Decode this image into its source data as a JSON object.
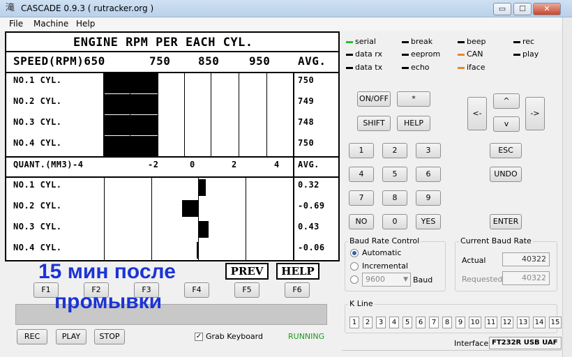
{
  "window": {
    "title": "CASCADE 0.9.3 ( rutracker.org )",
    "min": "▭",
    "max": "☐",
    "close": "✕",
    "app_icon": "滝"
  },
  "menu": [
    "File",
    "Machine",
    "Help"
  ],
  "lcd": {
    "title": "ENGINE RPM PER EACH CYL.",
    "rpm_header": {
      "label": "SPEED(RPM)650",
      "ticks": [
        "750",
        "850",
        "950"
      ],
      "avg": "AVG."
    },
    "rpm_rows": [
      {
        "label": "NO.1 CYL.",
        "value": "750"
      },
      {
        "label": "NO.2 CYL.",
        "value": "749"
      },
      {
        "label": "NO.3 CYL.",
        "value": "748"
      },
      {
        "label": "NO.4 CYL.",
        "value": "750"
      }
    ],
    "quant_header": {
      "label": "QUANT.(MM3)-4",
      "ticks": [
        "-2",
        "0",
        "2",
        "4"
      ],
      "avg": "AVG."
    },
    "quant_rows": [
      {
        "label": "NO.1 CYL.",
        "value": "0.32"
      },
      {
        "label": "NO.2 CYL.",
        "value": "-0.69"
      },
      {
        "label": "NO.3 CYL.",
        "value": "0.43"
      },
      {
        "label": "NO.4 CYL.",
        "value": "-0.06"
      }
    ],
    "softkeys": [
      "PREV",
      "HELP"
    ]
  },
  "overlay": {
    "line1": "15 мин после",
    "line2": "промывки"
  },
  "fkeys": [
    "F1",
    "F2",
    "F3",
    "F4",
    "F5",
    "F6"
  ],
  "bottom": {
    "rec": "REC",
    "play": "PLAY",
    "stop": "STOP",
    "grab_keyboard": "Grab Keyboard",
    "status": "RUNNING"
  },
  "leds": [
    {
      "label": "serial",
      "color": "#22c22a"
    },
    {
      "label": "break",
      "color": "#000000"
    },
    {
      "label": "beep",
      "color": "#000000"
    },
    {
      "label": "rec",
      "color": "#000000"
    },
    {
      "label": "data rx",
      "color": "#000000"
    },
    {
      "label": "eeprom",
      "color": "#000000"
    },
    {
      "label": "CAN",
      "color": "#e08a2c"
    },
    {
      "label": "play",
      "color": "#000000"
    },
    {
      "label": "data tx",
      "color": "#000000"
    },
    {
      "label": "echo",
      "color": "#000000"
    },
    {
      "label": "iface",
      "color": "#e08a2c"
    }
  ],
  "keys": {
    "onoff": "ON/OFF",
    "star": "*",
    "shift": "SHIFT",
    "help": "HELP",
    "left": "<-",
    "up": "^",
    "down": "v",
    "right": "->",
    "esc": "ESC",
    "undo": "UNDO",
    "enter": "ENTER",
    "no": "NO",
    "yes": "YES",
    "digits": [
      "1",
      "2",
      "3",
      "4",
      "5",
      "6",
      "7",
      "8",
      "9",
      "0"
    ]
  },
  "baud": {
    "title": "Baud Rate Control",
    "automatic": "Automatic",
    "incremental": "Incremental",
    "select_value": "9600",
    "baud_label": "Baud",
    "current_title": "Current Baud Rate",
    "actual_label": "Actual",
    "actual": "40322",
    "requested_label": "Requested",
    "requested": "40322"
  },
  "kline": {
    "title": "K Line",
    "cells": [
      "1",
      "2",
      "3",
      "4",
      "5",
      "6",
      "7",
      "8",
      "9",
      "10",
      "11",
      "12",
      "13",
      "14",
      "15"
    ]
  },
  "interface": {
    "label": "Interface",
    "value": "FT232R USB UAF"
  },
  "colors": {
    "overlay": "#1b34d6",
    "running": "#1a9a1a"
  },
  "rpm_bars": [
    0.75,
    0.75,
    0.75,
    0.75
  ],
  "quant_values": [
    0.32,
    -0.69,
    0.43,
    -0.06
  ]
}
